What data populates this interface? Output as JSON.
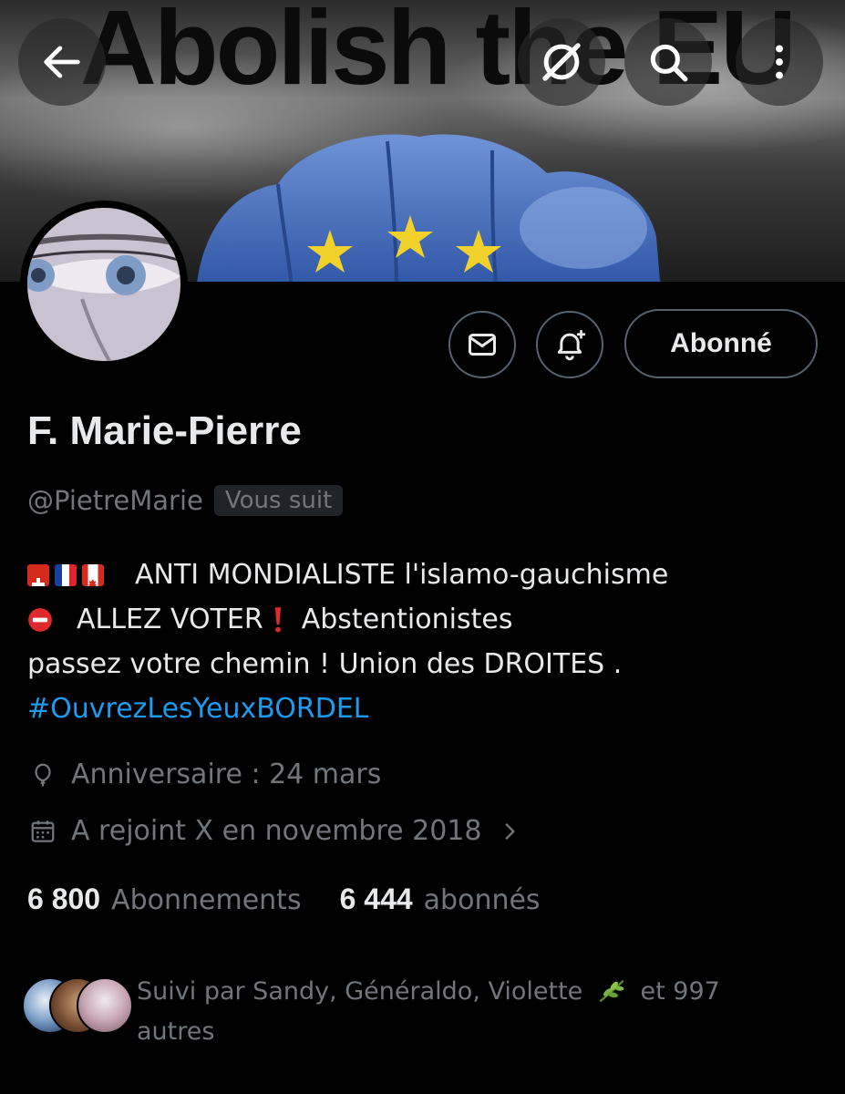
{
  "banner": {
    "text": "Abolish the EU"
  },
  "topbar": {
    "back_icon": "arrow-left-icon",
    "grok_icon": "grok-icon",
    "search_icon": "search-icon",
    "more_icon": "more-vertical-icon"
  },
  "actions": {
    "message_icon": "mail-icon",
    "notify_icon": "bell-plus-icon",
    "follow_label": "Abonné"
  },
  "profile": {
    "name": "F. Marie-Pierre",
    "handle": "@PietreMarie",
    "follows_you": "Vous suit",
    "bio": {
      "line1": "ANTI  MONDIALISTE l'islamo-gauchisme",
      "line2": "ALLEZ VOTER",
      "line2b": "Abstentionistes",
      "line3": "passez votre chemin ! Union des DROITES  .",
      "hashtag": "#OuvrezLesYeuxBORDEL"
    },
    "birthday": "Anniversaire : 24 mars",
    "joined": "A rejoint X en novembre 2018"
  },
  "stats": {
    "following_count": "6 800",
    "following_label": "Abonnements",
    "followers_count": "6 444",
    "followers_label": "abonnés"
  },
  "known_followers": {
    "text_line1": "Suivi par Sandy, Généraldo, Violette",
    "text_line1b": "et 997",
    "text_line2": "autres"
  },
  "colors": {
    "background": "#000000",
    "text": "#e7e9ea",
    "muted": "#71767b",
    "link": "#1d9bf0",
    "border": "#536471"
  }
}
